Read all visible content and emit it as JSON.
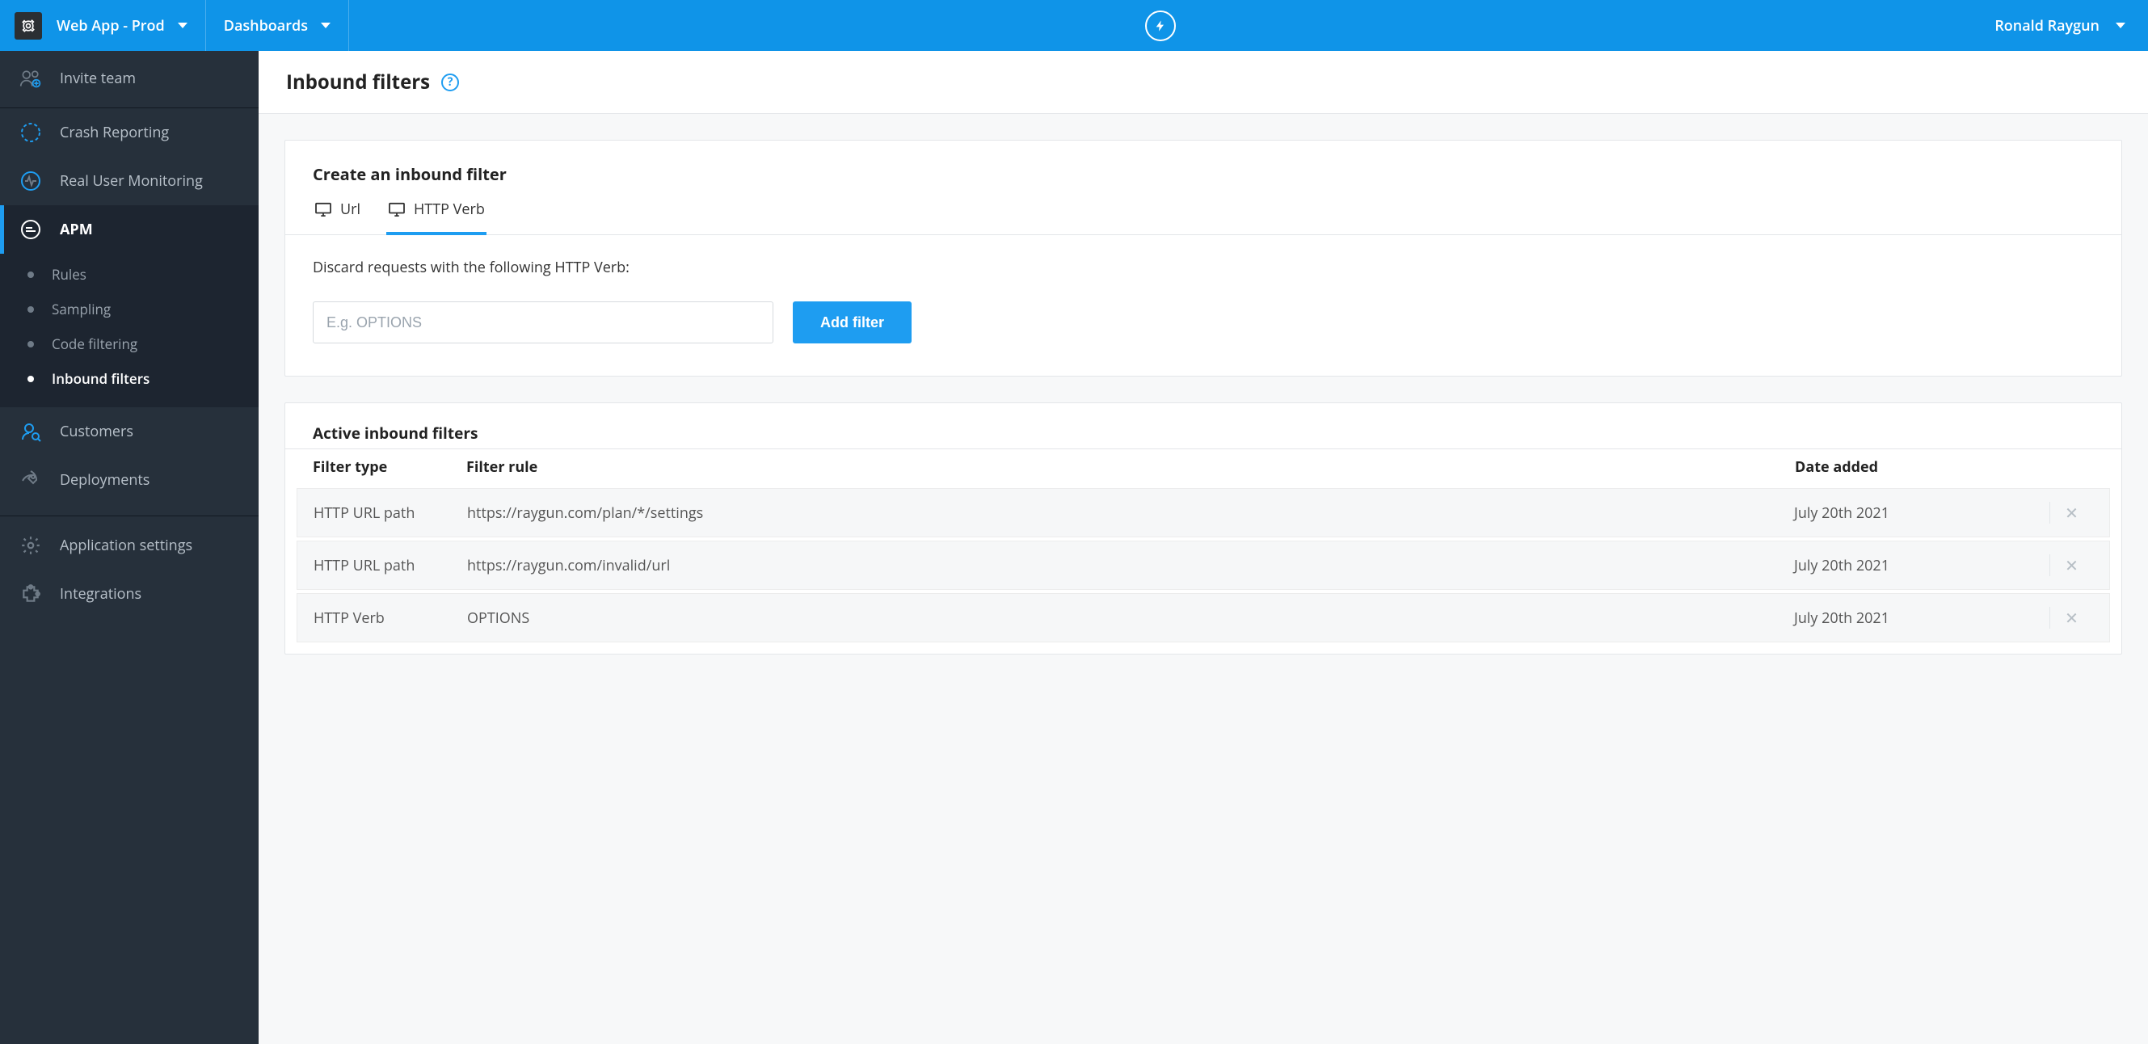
{
  "topbar": {
    "app_name": "Web App - Prod",
    "menu_label": "Dashboards",
    "user_name": "Ronald Raygun"
  },
  "sidebar": {
    "invite_label": "Invite team",
    "items": [
      {
        "label": "Crash Reporting"
      },
      {
        "label": "Real User Monitoring"
      },
      {
        "label": "APM"
      },
      {
        "label": "Customers"
      },
      {
        "label": "Deployments"
      },
      {
        "label": "Application settings"
      },
      {
        "label": "Integrations"
      }
    ],
    "apm_subitems": [
      {
        "label": "Rules"
      },
      {
        "label": "Sampling"
      },
      {
        "label": "Code filtering"
      },
      {
        "label": "Inbound filters"
      }
    ]
  },
  "page": {
    "title": "Inbound filters"
  },
  "create_card": {
    "heading": "Create an inbound filter",
    "tabs": {
      "url": "Url",
      "http_verb": "HTTP Verb"
    },
    "form_label": "Discard requests with the following HTTP Verb:",
    "placeholder": "E.g. OPTIONS",
    "button": "Add filter"
  },
  "active_card": {
    "heading": "Active inbound filters",
    "columns": {
      "type": "Filter type",
      "rule": "Filter rule",
      "date": "Date added"
    },
    "rows": [
      {
        "type": "HTTP URL path",
        "rule": "https://raygun.com/plan/*/settings",
        "date": "July 20th 2021"
      },
      {
        "type": "HTTP URL path",
        "rule": "https://raygun.com/invalid/url",
        "date": "July 20th 2021"
      },
      {
        "type": "HTTP Verb",
        "rule": "OPTIONS",
        "date": "July 20th 2021"
      }
    ]
  }
}
